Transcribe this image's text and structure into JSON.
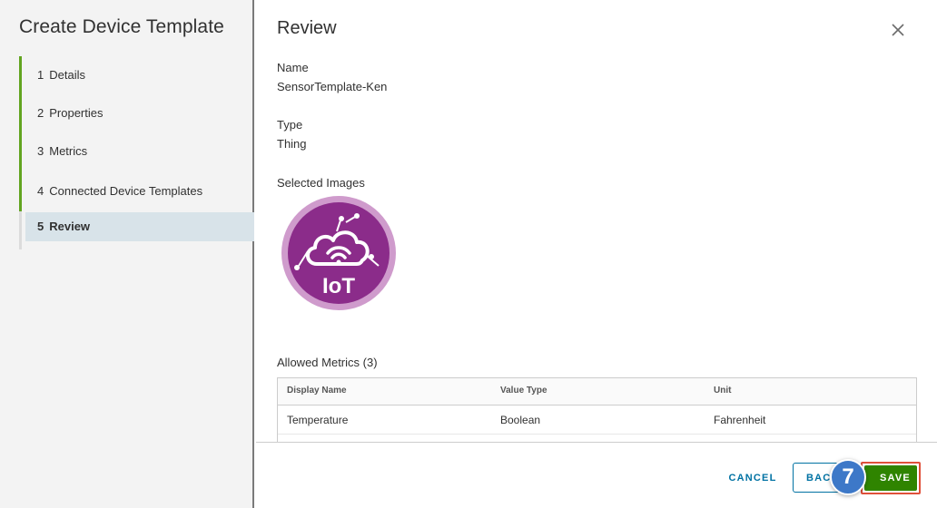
{
  "sidebar": {
    "title": "Create Device Template",
    "steps": [
      {
        "num": "1",
        "label": "Details"
      },
      {
        "num": "2",
        "label": "Properties"
      },
      {
        "num": "3",
        "label": "Metrics"
      },
      {
        "num": "4",
        "label": "Connected Device Templates"
      },
      {
        "num": "5",
        "label": "Review"
      }
    ]
  },
  "main": {
    "title": "Review",
    "close_icon": "close-icon",
    "name_label": "Name",
    "name_value": "SensorTemplate-Ken",
    "type_label": "Type",
    "type_value": "Thing",
    "images_label": "Selected Images",
    "image_text": "IoT",
    "metrics_label": "Allowed Metrics (3)",
    "grid": {
      "columns": [
        "Display Name",
        "Value Type",
        "Unit"
      ],
      "rows": [
        [
          "Temperature",
          "Boolean",
          "Fahrenheit"
        ]
      ]
    }
  },
  "footer": {
    "cancel_label": "CANCEL",
    "back_label": "BACK",
    "save_label": "SAVE",
    "step_badge": "7"
  },
  "colors": {
    "accent_green": "#62a420",
    "save_green": "#2f8400",
    "link_blue": "#0072a3",
    "iot_purple": "#8b2c8a",
    "highlight_red": "#e0503a"
  }
}
